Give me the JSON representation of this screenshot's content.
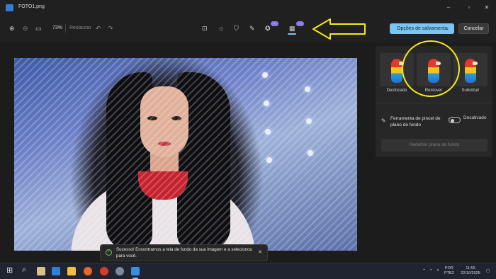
{
  "window": {
    "file_name": "FOTO1.png",
    "minimize": "–",
    "maximize": "▫",
    "close": "✕"
  },
  "toolbar": {
    "zoom_value": "73%",
    "restore_label": "Restaurar",
    "badge_1": "⁺",
    "badge_2": "⁺",
    "save_options_label": "Opções de salvamento",
    "cancel_label": "Cancelar"
  },
  "background_panel": {
    "options": [
      {
        "label": "Desfocado"
      },
      {
        "label": "Remover"
      },
      {
        "label": "Substituir"
      }
    ],
    "brush_tool_label": "Ferramenta de pincel de plano de fundo",
    "toggle_state": "Desativado",
    "reset_label": "Redefinir plano de fundo"
  },
  "toast": {
    "message": "Sucesso! Encontramos a tela de fundo da sua imagem e a selecionou para você.",
    "close": "✕"
  },
  "taskbar": {
    "lang_line1": "POR",
    "lang_line2": "PTB2",
    "time": "11:55",
    "date": "22/10/2025"
  },
  "colors": {
    "accent": "#7cc4f2",
    "annotation": "#f4ea1a",
    "toast_success": "#6ccb5f"
  }
}
